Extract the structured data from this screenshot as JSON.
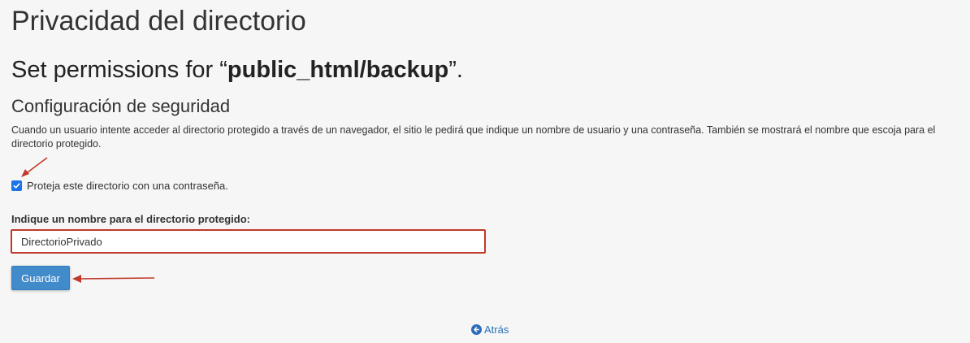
{
  "page": {
    "title": "Privacidad del directorio",
    "permissions_prefix": "Set permissions for “",
    "permissions_path": "public_html/backup",
    "permissions_suffix": "”."
  },
  "security": {
    "heading": "Configuración de seguridad",
    "description": "Cuando un usuario intente acceder al directorio protegido a través de un navegador, el sitio le pedirá que indique un nombre de usuario y una contraseña. También se mostrará el nombre que escoja para el directorio protegido.",
    "protect_checkbox_label": "Proteja este directorio con una contraseña.",
    "protect_checked": true,
    "name_label": "Indique un nombre para el directorio protegido:",
    "name_value": "DirectorioPrivado",
    "save_label": "Guardar"
  },
  "footer": {
    "back_label": "Atrás"
  },
  "colors": {
    "accent": "#428bca",
    "annotation": "#c0392b",
    "link": "#2a6ebb"
  }
}
